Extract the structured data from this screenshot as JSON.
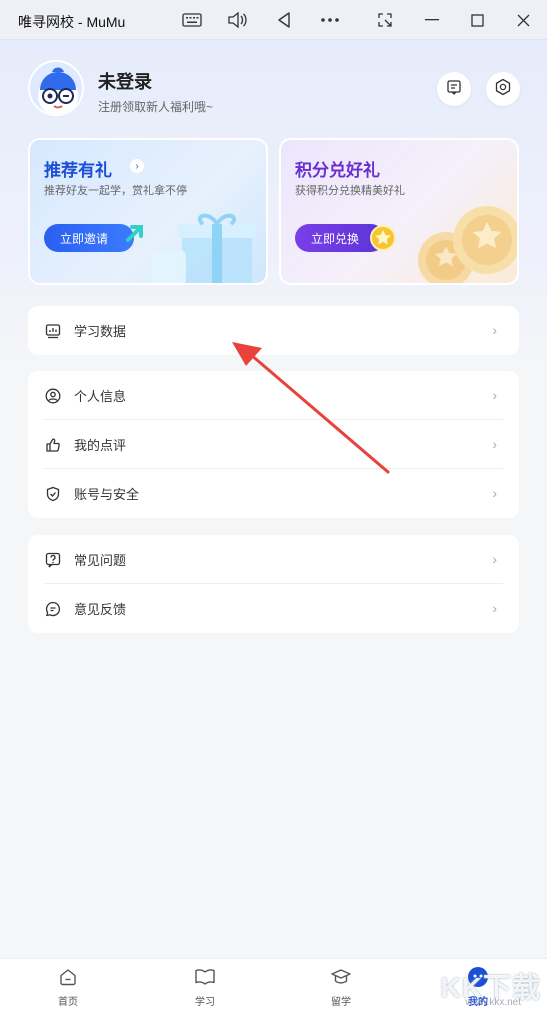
{
  "window": {
    "title": "唯寻网校 - MuMu",
    "controls": [
      "keyboard-icon",
      "volume-icon",
      "back-icon",
      "more-icon",
      "screenshot-icon",
      "minimize-icon",
      "maximize-icon",
      "close-icon"
    ]
  },
  "profile": {
    "name": "未登录",
    "subtitle": "注册领取新人福利哦~"
  },
  "promo_cards": [
    {
      "title": "推荐有礼",
      "desc": "推荐好友一起学，赏礼拿不停",
      "button": "立即邀请",
      "accent": "#1b4fd6"
    },
    {
      "title": "积分兑好礼",
      "desc": "获得积分兑换精美好礼",
      "button": "立即兑换",
      "accent": "#6a2fd1"
    }
  ],
  "menu_groups": [
    [
      {
        "label": "学习数据",
        "icon": "chart-icon"
      }
    ],
    [
      {
        "label": "个人信息",
        "icon": "user-icon"
      },
      {
        "label": "我的点评",
        "icon": "thumbs-up-icon"
      },
      {
        "label": "账号与安全",
        "icon": "shield-icon"
      }
    ],
    [
      {
        "label": "常见问题",
        "icon": "question-icon"
      },
      {
        "label": "意见反馈",
        "icon": "feedback-icon"
      }
    ]
  ],
  "tabbar": [
    {
      "label": "首页",
      "icon": "home-icon",
      "active": false
    },
    {
      "label": "学习",
      "icon": "book-icon",
      "active": false
    },
    {
      "label": "留学",
      "icon": "graduation-cap-icon",
      "active": false
    },
    {
      "label": "我的",
      "icon": "profile-icon",
      "active": true
    }
  ],
  "watermark": {
    "text": "KK下载",
    "sub": "www.kkx.net"
  }
}
